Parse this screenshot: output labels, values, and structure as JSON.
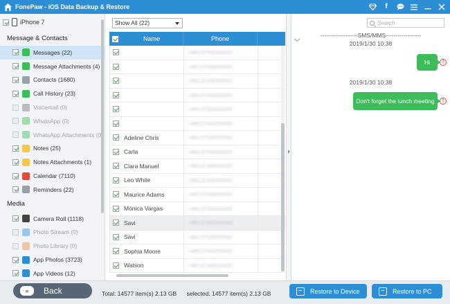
{
  "window": {
    "title": "FonePaw - iOS Data Backup & Restore",
    "icons": [
      "diamond-icon",
      "facebook-icon",
      "chat-icon",
      "menu-icon",
      "minimize-icon",
      "close-icon"
    ]
  },
  "sidebar": {
    "device": "iPhone 7",
    "sections": [
      {
        "label": "Message & Contacts",
        "items": [
          {
            "label": "Messages (22)",
            "checked": true,
            "active": true,
            "dim": false,
            "icon": "messages-icon",
            "color": "#3dbd5a"
          },
          {
            "label": "Message Attachments (4)",
            "checked": true,
            "active": false,
            "dim": false,
            "icon": "message-attachments-icon",
            "color": "#3dbd5a"
          },
          {
            "label": "Contacts (1680)",
            "checked": true,
            "active": false,
            "dim": false,
            "icon": "contacts-icon",
            "color": "#9aa1a8"
          },
          {
            "label": "Call History (23)",
            "checked": true,
            "active": false,
            "dim": false,
            "icon": "call-history-icon",
            "color": "#3dbd5a"
          },
          {
            "label": "Voicemail (0)",
            "checked": false,
            "active": false,
            "dim": true,
            "icon": "voicemail-icon",
            "color": "#777777"
          },
          {
            "label": "WhatsApp (0)",
            "checked": false,
            "active": false,
            "dim": true,
            "icon": "whatsapp-icon",
            "color": "#3dbd5a"
          },
          {
            "label": "WhatsApp Attachments (0)",
            "checked": false,
            "active": false,
            "dim": true,
            "icon": "whatsapp-attachments-icon",
            "color": "#3dbd5a"
          },
          {
            "label": "Notes (25)",
            "checked": true,
            "active": false,
            "dim": false,
            "icon": "notes-icon",
            "color": "#f2c94c"
          },
          {
            "label": "Notes Attachments (1)",
            "checked": true,
            "active": false,
            "dim": false,
            "icon": "notes-attachments-icon",
            "color": "#f2c94c"
          },
          {
            "label": "Calendar (7110)",
            "checked": true,
            "active": false,
            "dim": false,
            "icon": "calendar-icon",
            "color": "#e24a3b"
          },
          {
            "label": "Reminders (22)",
            "checked": true,
            "active": false,
            "dim": false,
            "icon": "reminders-icon",
            "color": "#9aa1a8"
          }
        ]
      },
      {
        "label": "Media",
        "items": [
          {
            "label": "Camera Roll (1118)",
            "checked": true,
            "active": false,
            "dim": false,
            "icon": "camera-roll-icon",
            "color": "#444444"
          },
          {
            "label": "Photo Stream (0)",
            "checked": false,
            "active": false,
            "dim": true,
            "icon": "photo-stream-icon",
            "color": "#2c8fd6"
          },
          {
            "label": "Photo Library (0)",
            "checked": false,
            "active": false,
            "dim": true,
            "icon": "photo-library-icon",
            "color": "#e2904a"
          },
          {
            "label": "App Photos (3723)",
            "checked": true,
            "active": false,
            "dim": false,
            "icon": "app-photos-icon",
            "color": "#2c8fd6"
          },
          {
            "label": "App Videos (12)",
            "checked": true,
            "active": false,
            "dim": false,
            "icon": "app-videos-icon",
            "color": "#2c8fd6"
          }
        ]
      }
    ]
  },
  "list": {
    "filter": "Show All (22)",
    "columns": {
      "name": "Name",
      "phone": "Phone"
    },
    "rows": [
      {
        "name": "",
        "phone": "+8613700000000"
      },
      {
        "name": "",
        "phone": "+8613700000000"
      },
      {
        "name": "",
        "phone": "+8613700000000"
      },
      {
        "name": "",
        "phone": "+8613700000000"
      },
      {
        "name": "",
        "phone": "+8613700000000"
      },
      {
        "name": "",
        "phone": "+8613700000000"
      },
      {
        "name": "Adeline Chris",
        "phone": "+8613700000000"
      },
      {
        "name": "Carla",
        "phone": "+8613700000000"
      },
      {
        "name": "Clara Manuel",
        "phone": "+8613700000000"
      },
      {
        "name": "Leo White",
        "phone": "+8613700000000"
      },
      {
        "name": "Maurice Adams",
        "phone": "+8613700000000"
      },
      {
        "name": "Mónica Vargas",
        "phone": "+8613700000000"
      },
      {
        "name": "Savi",
        "phone": "+8613700000000"
      },
      {
        "name": "Savi",
        "phone": "+8613700000000"
      },
      {
        "name": "Sophia Moore",
        "phone": "+8613700000000"
      },
      {
        "name": "Watson",
        "phone": "+8613700000000"
      }
    ]
  },
  "chat": {
    "search_placeholder": "Search",
    "header": "-------------------SMS/MMS------------------",
    "messages": [
      {
        "time": "2019/1/30 10:38",
        "text": "Hi"
      },
      {
        "time": "2019/1/30 10:38",
        "text": "Don't forget the lunch meeting"
      }
    ]
  },
  "footer": {
    "back": "Back",
    "total": "Total: 14577 item(s) 2.13 GB",
    "selected": "selected: 14577 item(s) 2.13 GB",
    "restore_device": "Restore to Device",
    "restore_pc": "Restore to PC"
  },
  "colors": {
    "accent": "#2c8fd6",
    "bubble": "#3dbd5a",
    "warning": "#e24a3b",
    "back_button": "#566675"
  }
}
